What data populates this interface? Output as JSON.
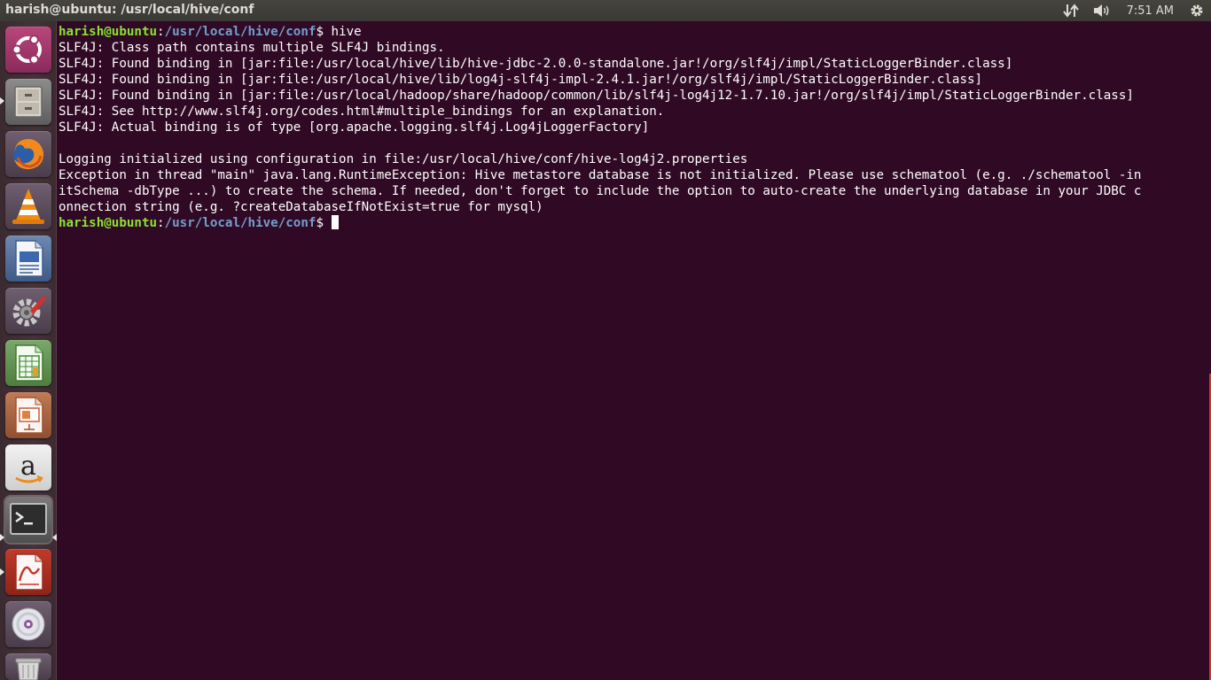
{
  "window": {
    "title": "harish@ubuntu: /usr/local/hive/conf"
  },
  "panel": {
    "clock": "7:51 AM",
    "indicators": [
      "network-icon",
      "volume-icon",
      "gear-icon"
    ]
  },
  "launcher": {
    "items": [
      {
        "name": "ubuntu-dash",
        "icon": "ubuntu-logo-icon"
      },
      {
        "name": "files",
        "icon": "file-cabinet-icon"
      },
      {
        "name": "firefox",
        "icon": "firefox-icon"
      },
      {
        "name": "vlc",
        "icon": "vlc-cone-icon"
      },
      {
        "name": "libreoffice-writer",
        "icon": "writer-document-icon"
      },
      {
        "name": "system-settings",
        "icon": "settings-wrench-icon"
      },
      {
        "name": "libreoffice-calc",
        "icon": "calc-spreadsheet-icon"
      },
      {
        "name": "libreoffice-impress",
        "icon": "impress-presentation-icon"
      },
      {
        "name": "amazon",
        "icon": "amazon-icon"
      },
      {
        "name": "terminal",
        "icon": "terminal-icon"
      },
      {
        "name": "document-viewer",
        "icon": "pdf-viewer-icon"
      },
      {
        "name": "disc",
        "icon": "disc-icon"
      },
      {
        "name": "trash",
        "icon": "trash-icon"
      }
    ]
  },
  "terminal": {
    "prompt_user": "harish@ubuntu",
    "prompt_sep": ":",
    "prompt_path": "/usr/local/hive/conf",
    "prompt_symbol": "$ ",
    "command": "hive",
    "output": [
      "SLF4J: Class path contains multiple SLF4J bindings.",
      "SLF4J: Found binding in [jar:file:/usr/local/hive/lib/hive-jdbc-2.0.0-standalone.jar!/org/slf4j/impl/StaticLoggerBinder.class]",
      "SLF4J: Found binding in [jar:file:/usr/local/hive/lib/log4j-slf4j-impl-2.4.1.jar!/org/slf4j/impl/StaticLoggerBinder.class]",
      "SLF4J: Found binding in [jar:file:/usr/local/hadoop/share/hadoop/common/lib/slf4j-log4j12-1.7.10.jar!/org/slf4j/impl/StaticLoggerBinder.class]",
      "SLF4J: See http://www.slf4j.org/codes.html#multiple_bindings for an explanation.",
      "SLF4J: Actual binding is of type [org.apache.logging.slf4j.Log4jLoggerFactory]",
      "",
      "Logging initialized using configuration in file:/usr/local/hive/conf/hive-log4j2.properties",
      "Exception in thread \"main\" java.lang.RuntimeException: Hive metastore database is not initialized. Please use schematool (e.g. ./schematool -in",
      "itSchema -dbType ...) to create the schema. If needed, don't forget to include the option to auto-create the underlying database in your JDBC c",
      "onnection string (e.g. ?createDatabaseIfNotExist=true for mysql)"
    ]
  }
}
